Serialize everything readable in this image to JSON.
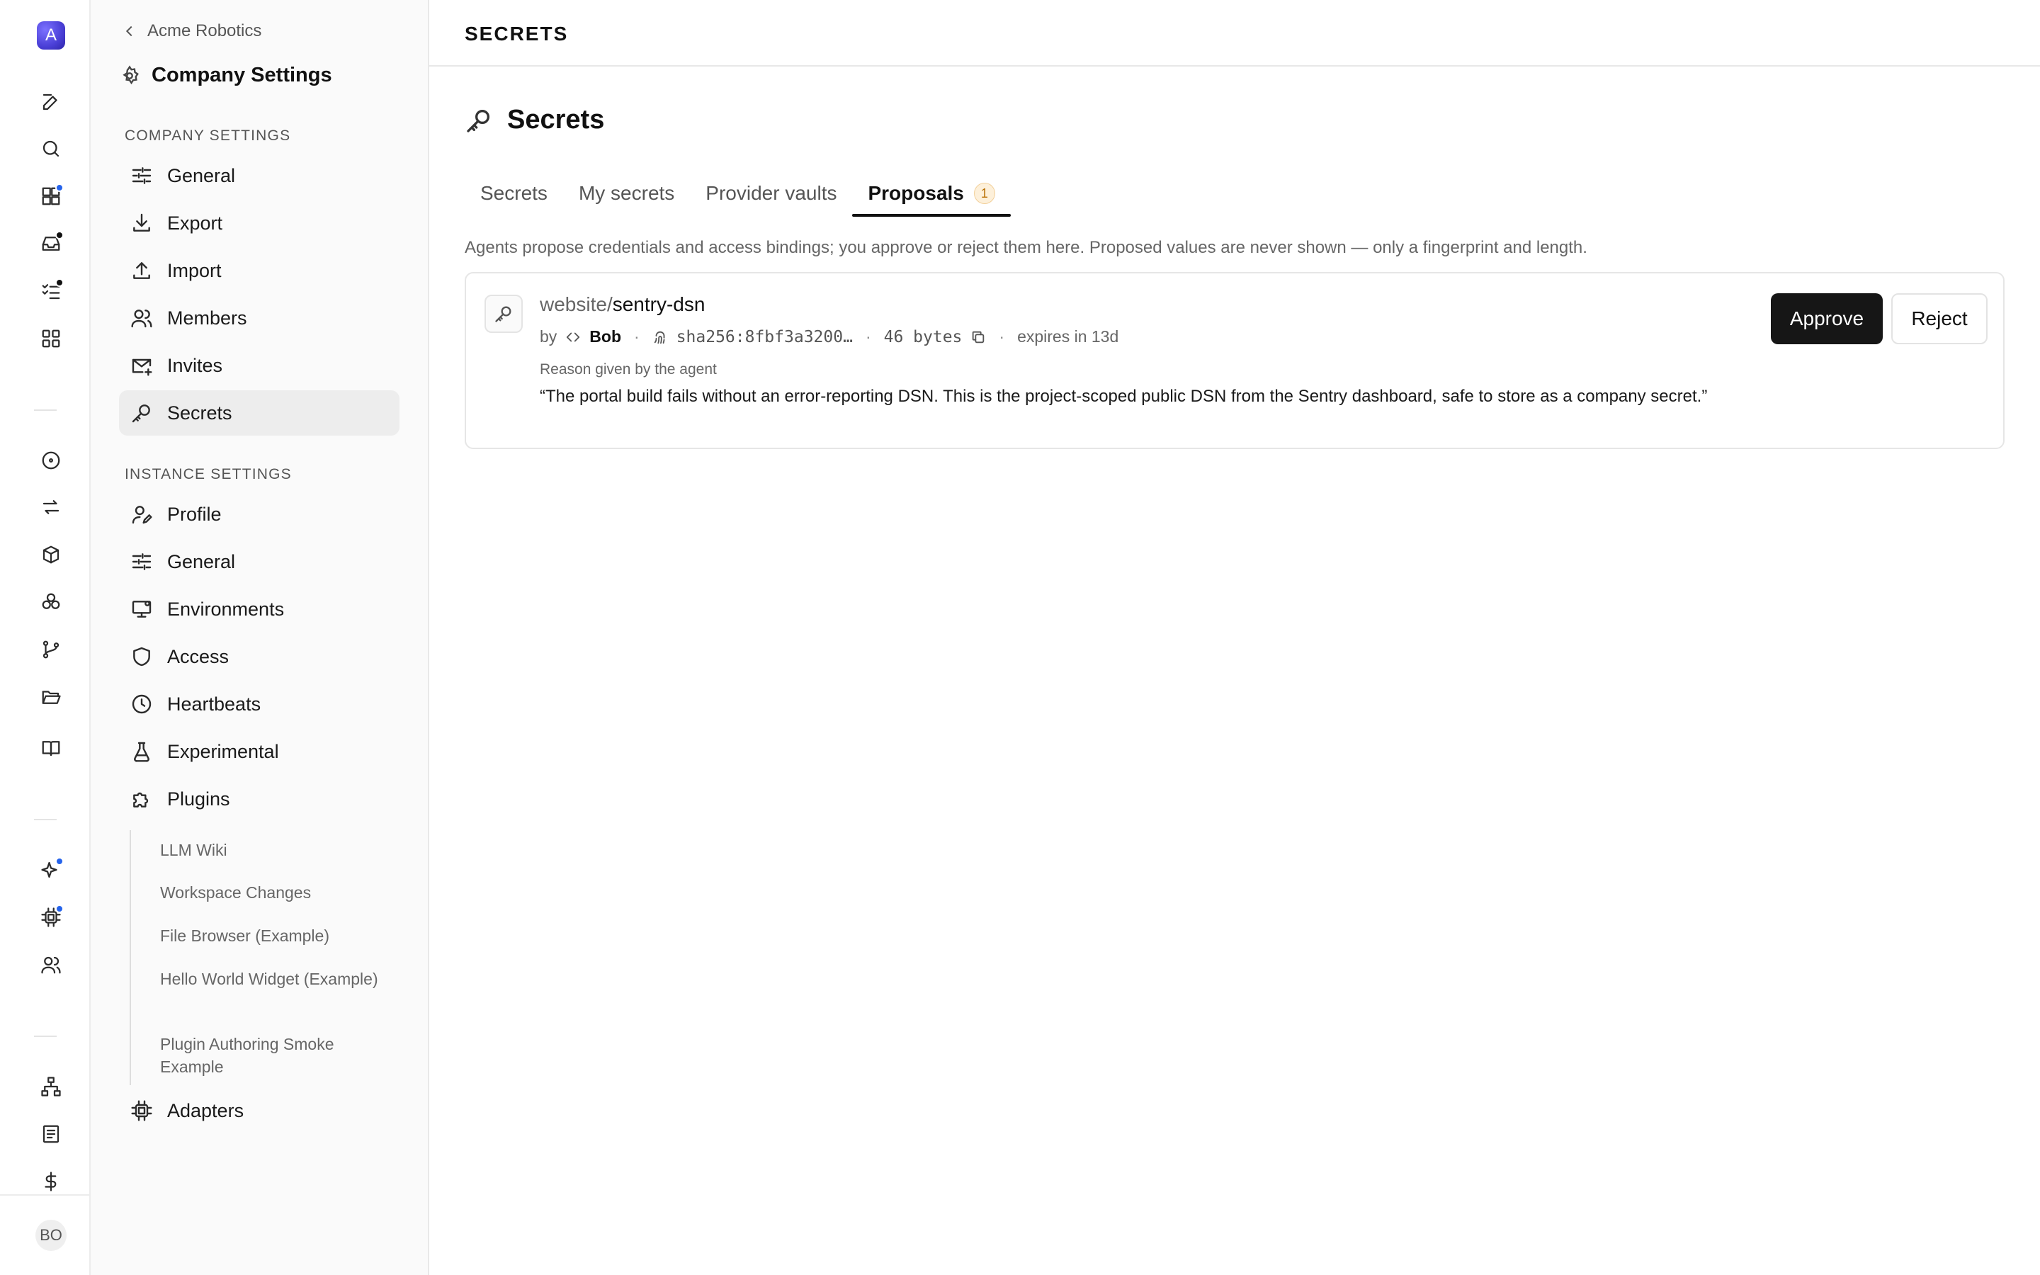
{
  "app": {
    "logo_letter": "A",
    "user_initials": "BO",
    "accent_color": "#4a3fd6"
  },
  "rail": {
    "icons": [
      {
        "name": "compose-icon"
      },
      {
        "name": "search-icon"
      },
      {
        "name": "dashboard-icon",
        "dot": "#2563eb"
      },
      {
        "name": "inbox-icon",
        "dot": "#111111"
      },
      {
        "name": "tasks-icon",
        "dot": "#111111"
      },
      {
        "name": "apps-grid-icon"
      },
      {
        "name": "target-icon"
      },
      {
        "name": "sync-icon"
      },
      {
        "name": "package-icon"
      },
      {
        "name": "cluster-icon"
      },
      {
        "name": "git-branch-icon"
      },
      {
        "name": "folder-open-icon"
      },
      {
        "name": "book-icon"
      },
      {
        "name": "sparkles-icon",
        "dot": "#2563eb"
      },
      {
        "name": "chip-icon",
        "dot": "#2563eb"
      },
      {
        "name": "users-icon"
      },
      {
        "name": "org-chart-icon"
      },
      {
        "name": "document-icon"
      },
      {
        "name": "dollar-icon"
      }
    ]
  },
  "sidebar": {
    "back_label": "Acme Robotics",
    "title": "Company Settings",
    "company_section_label": "COMPANY SETTINGS",
    "company_items": [
      {
        "label": "General",
        "icon": "sliders-icon"
      },
      {
        "label": "Export",
        "icon": "download-icon"
      },
      {
        "label": "Import",
        "icon": "upload-icon"
      },
      {
        "label": "Members",
        "icon": "members-icon"
      },
      {
        "label": "Invites",
        "icon": "mail-plus-icon"
      },
      {
        "label": "Secrets",
        "icon": "key-icon",
        "active": true
      }
    ],
    "instance_section_label": "INSTANCE SETTINGS",
    "instance_items": [
      {
        "label": "Profile",
        "icon": "user-edit-icon"
      },
      {
        "label": "General",
        "icon": "sliders-icon"
      },
      {
        "label": "Environments",
        "icon": "monitor-icon"
      },
      {
        "label": "Access",
        "icon": "shield-icon"
      },
      {
        "label": "Heartbeats",
        "icon": "clock-icon"
      },
      {
        "label": "Experimental",
        "icon": "flask-icon"
      },
      {
        "label": "Plugins",
        "icon": "puzzle-icon"
      }
    ],
    "plugins": [
      "LLM Wiki",
      "Workspace Changes",
      "File Browser (Example)",
      "Hello World Widget (Example)",
      "Plugin Authoring Smoke Example"
    ],
    "adapters_label": "Adapters"
  },
  "header": {
    "breadcrumb": "SECRETS"
  },
  "page": {
    "title": "Secrets",
    "tabs": [
      {
        "label": "Secrets"
      },
      {
        "label": "My secrets"
      },
      {
        "label": "Provider vaults"
      },
      {
        "label": "Proposals",
        "badge": "1",
        "active": true
      }
    ],
    "description": "Agents propose credentials and access bindings; you approve or reject them here. Proposed values are never shown — only a fingerprint and length.",
    "proposal": {
      "namespace": "website/",
      "key": "sentry-dsn",
      "by_label": "by",
      "author": "Bob",
      "fingerprint": "sha256:8fbf3a3200…",
      "length": "46 bytes",
      "expires": "expires in 13d",
      "reason_label": "Reason given by the agent",
      "reason": "“The portal build fails without an error-reporting DSN. This is the project-scoped public DSN from the Sentry dashboard, safe to store as a company secret.”",
      "approve_label": "Approve",
      "reject_label": "Reject"
    }
  }
}
